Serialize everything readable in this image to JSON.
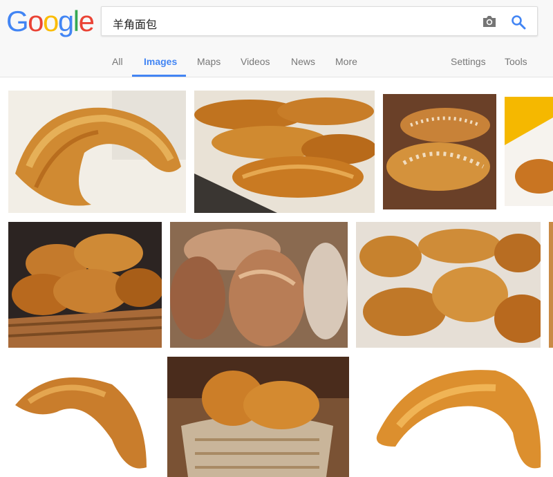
{
  "logo": {
    "letters": [
      "G",
      "o",
      "o",
      "g",
      "l",
      "e"
    ],
    "colors": [
      "#4285f4",
      "#ea4335",
      "#fbbc05",
      "#4285f4",
      "#34a853",
      "#ea4335"
    ]
  },
  "search": {
    "query": "羊角面包"
  },
  "icons": {
    "camera": "camera-icon",
    "search": "search-icon"
  },
  "tabs": {
    "all": "All",
    "images": "Images",
    "maps": "Maps",
    "videos": "Videos",
    "news": "News",
    "more": "More",
    "settings": "Settings",
    "tools": "Tools"
  },
  "colors": {
    "accent": "#4285f4",
    "tab_text": "#777777"
  },
  "results": [
    {
      "subject": "croissant"
    },
    {
      "subject": "croissants"
    },
    {
      "subject": "croissants"
    },
    {
      "subject": "croissant"
    },
    {
      "subject": "croissants in basket"
    },
    {
      "subject": "croissants in basket"
    },
    {
      "subject": "croissants"
    },
    {
      "subject": "croissant"
    },
    {
      "subject": "croissant"
    },
    {
      "subject": "croissants in basket"
    },
    {
      "subject": "croissant"
    }
  ]
}
